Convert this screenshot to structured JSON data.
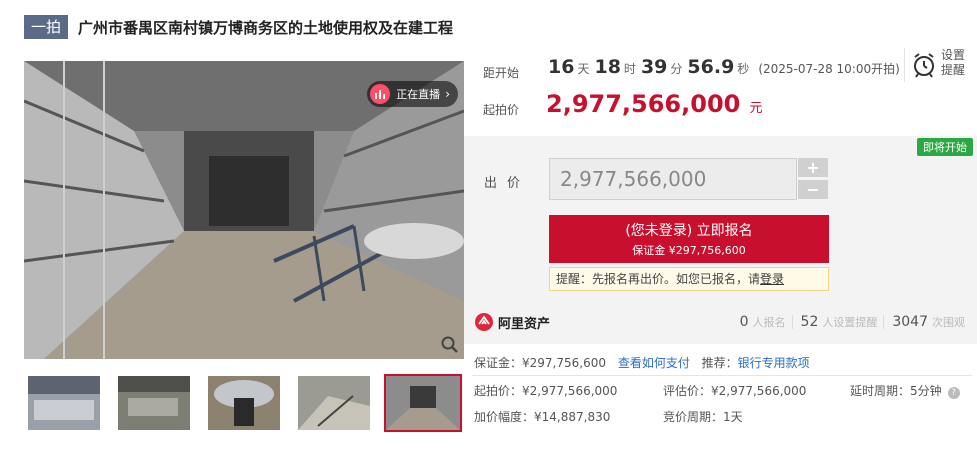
{
  "header": {
    "badge": "一拍",
    "title": "广州市番禺区南村镇万博商务区的土地使用权及在建工程"
  },
  "gallery": {
    "live_label": "正在直播",
    "live_chevron": "›",
    "thumbnail_count": 5,
    "selected_index": 4
  },
  "countdown": {
    "label": "距开始",
    "days": "16",
    "days_unit": "天",
    "hours": "18",
    "hours_unit": "时",
    "minutes": "39",
    "minutes_unit": "分",
    "seconds": "56.9",
    "seconds_unit": "秒",
    "start_note": "(2025-07-28 10:00开拍)"
  },
  "reminder": {
    "line1": "设置",
    "line2": "提醒",
    "icon": "alarm-clock-icon"
  },
  "start_price": {
    "label": "起拍价",
    "value": "2,977,566,000",
    "unit": "元"
  },
  "bid": {
    "status_tag": "即将开始",
    "label": "出价",
    "input_value": "2,977,566,000",
    "plus": "+",
    "minus": "−",
    "apply_main": "(您未登录) 立即报名",
    "apply_sub": "保证金 ¥297,756,600",
    "tip_prefix": "提醒：先报名再出价。如您已报名，请",
    "tip_link": "登录"
  },
  "platform": {
    "name": "阿里资产",
    "stats": [
      {
        "num": "0",
        "label": "人报名"
      },
      {
        "num": "52",
        "label": "人设置提醒"
      },
      {
        "num": "3047",
        "label": "次围观"
      }
    ]
  },
  "details": {
    "deposit": "保证金：¥297,756,600",
    "how_to_pay": "查看如何支付",
    "recommend_label": "推荐：",
    "recommend_link": "银行专用款项",
    "start_price": "起拍价：¥2,977,566,000",
    "appraisal": "评估价：¥2,977,566,000",
    "delay": "延时周期：5分钟",
    "increment": "加价幅度：¥14,887,830",
    "bid_cycle": "竞价周期：1天"
  },
  "colors": {
    "accent": "#c8102e",
    "badge": "#5b6a87",
    "tag_green": "#2aa845",
    "link": "#2a6ec7"
  }
}
